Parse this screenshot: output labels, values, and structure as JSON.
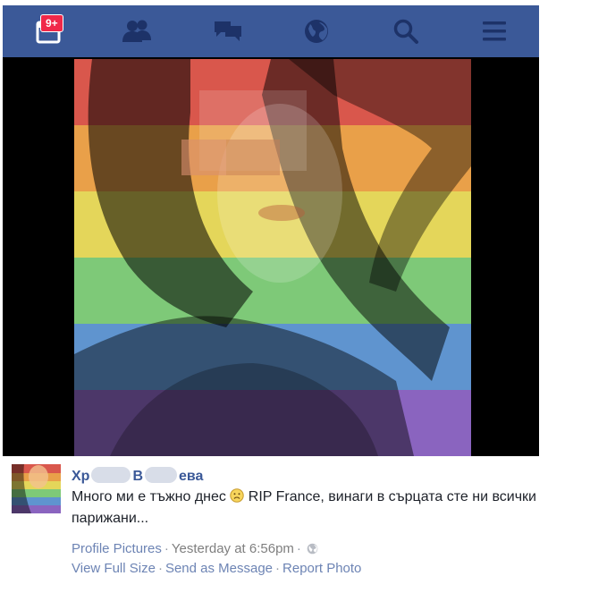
{
  "topbar": {
    "notification_badge": "9+",
    "icons": [
      "notifications-icon",
      "friend-requests-icon",
      "messages-icon",
      "globe-icon",
      "search-icon",
      "menu-icon"
    ],
    "background": "#3b5998"
  },
  "photo": {
    "description_icon": "rainbow-filtered-profile-photo",
    "stripe_colors": [
      "#e8463e",
      "#f4a340",
      "#f1e152",
      "#5fc36a",
      "#3d87c9",
      "#7a4bb4"
    ]
  },
  "post": {
    "name_part1": "Хр",
    "name_part2": "В",
    "name_part3": "ева",
    "text_before_emoji": "Много ми е тъжно днес ",
    "text_after_emoji": " RIP France, винаги в сърцата сте ни всички парижани...",
    "album": "Profile Pictures",
    "timestamp": "Yesterday at 6:56pm",
    "actions": [
      "View Full Size",
      "Send as Message",
      "Report Photo"
    ]
  }
}
